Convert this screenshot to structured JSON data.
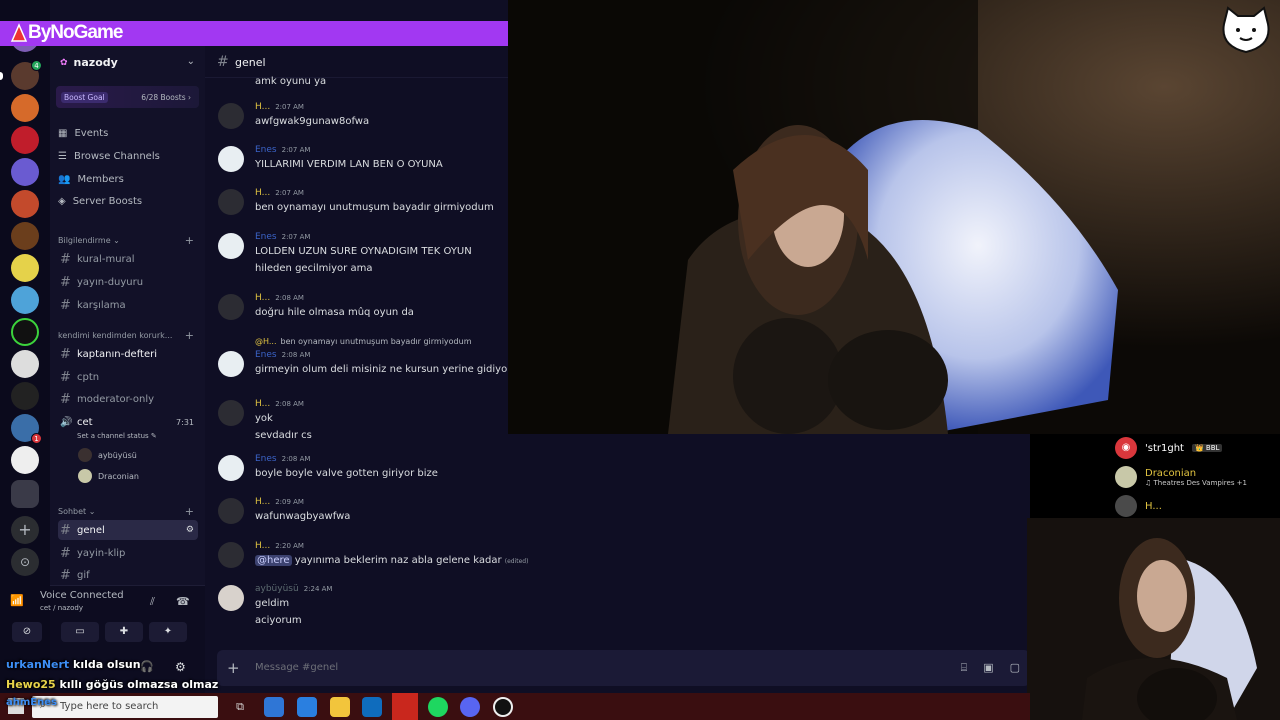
{
  "brand": {
    "text": "ByNoGame"
  },
  "server": {
    "name": "nazody",
    "boost_goal_label": "Boost Goal",
    "boost_progress": "6/28 Boosts"
  },
  "nav": [
    {
      "label": "Events",
      "icon": "calendar-icon"
    },
    {
      "label": "Browse Channels",
      "icon": "browse-icon"
    },
    {
      "label": "Members",
      "icon": "members-icon"
    },
    {
      "label": "Server Boosts",
      "icon": "boost-icon"
    }
  ],
  "categories": {
    "info": "Bilgilendirme",
    "self": "kendimi kendimden korurk...",
    "chat": "Sohbet"
  },
  "channels_info": [
    "kural-mural",
    "yayın-duyuru",
    "karşılama"
  ],
  "channels_self": [
    "kaptanın-defteri",
    "cptn",
    "moderator-only"
  ],
  "voice_channel": {
    "name": "cet",
    "time": "7:31",
    "status": "Set a channel status",
    "users": [
      "aybüyüsü",
      "Draconian"
    ]
  },
  "channels_chat": [
    "genel",
    "yayin-klip",
    "gif"
  ],
  "voice_panel": {
    "title": "Voice Connected",
    "sub": "cet / nazody"
  },
  "chat": {
    "channel": "genel",
    "top_text": "amk oyunu ya",
    "messages": [
      {
        "user": "H...",
        "time": "2:07 AM",
        "lines": [
          "awfgwak9gunaw8ofwa"
        ],
        "color": "yellow",
        "av": "dark"
      },
      {
        "user": "Enes",
        "time": "2:07 AM",
        "lines": [
          "YILLARIMI VERDIM LAN BEN O OYUNA"
        ],
        "color": "blue",
        "av": "ghost"
      },
      {
        "user": "H...",
        "time": "2:07 AM",
        "lines": [
          "ben oynamayı unutmuşum bayadır girmiyodum"
        ],
        "color": "yellow",
        "av": "dark"
      },
      {
        "user": "Enes",
        "time": "2:07 AM",
        "lines": [
          "LOLDEN UZUN SURE OYNADIGIM TEK OYUN",
          "hileden gecilmiyor ama"
        ],
        "color": "blue",
        "av": "ghost"
      },
      {
        "user": "H...",
        "time": "2:08 AM",
        "lines": [
          "doğru hile olmasa mûq oyun da"
        ],
        "color": "yellow",
        "av": "dark"
      },
      {
        "user": "Enes",
        "time": "2:08 AM",
        "lines": [
          "girmeyin olum deli misiniz ne kursun yerine gidiyor ne hile"
        ],
        "color": "blue",
        "av": "ghost",
        "reply_user": "@H...",
        "reply_text": "ben oynamayı unutmuşum bayadır girmiyodum"
      },
      {
        "user": "H...",
        "time": "2:08 AM",
        "lines": [
          "yok",
          "sevdadır cs"
        ],
        "color": "yellow",
        "av": "dark"
      },
      {
        "user": "Enes",
        "time": "2:08 AM",
        "lines": [
          "boyle boyle valve gotten giriyor bize"
        ],
        "color": "blue",
        "av": "ghost"
      },
      {
        "user": "H...",
        "time": "2:09 AM",
        "lines": [
          "wafunwagbyawfwa"
        ],
        "color": "yellow",
        "av": "dark"
      },
      {
        "user": "H...",
        "time": "2:20 AM",
        "lines": [
          "yayınıma beklerim naz abla gelene kadar"
        ],
        "color": "yellow",
        "av": "dark",
        "mention": "@here",
        "edited": "(edited)"
      },
      {
        "user": "aybüyüsü",
        "time": "2:24 AM",
        "lines": [
          "geldim",
          "aciyorum"
        ],
        "color": "grey",
        "av": "girl"
      }
    ],
    "composer_placeholder": "Message #genel"
  },
  "voice_overlay": [
    {
      "name": "'str1ght",
      "badge": "BBL",
      "sub": ""
    },
    {
      "name": "Draconian",
      "badge": "",
      "sub": "Theatres Des Vampires +1"
    },
    {
      "name": "H...",
      "badge": "",
      "sub": ""
    }
  ],
  "chat_overlay": [
    {
      "name": "urkanNert",
      "text": "kılda olsun"
    },
    {
      "name": "Hewo25",
      "text": "kıllı göğüs olmazsa olmaz"
    }
  ],
  "taskbar": {
    "search_placeholder": "Type here to search",
    "overlay_name": "ahmEnes"
  },
  "colors": {
    "brand": "#a238f2",
    "discord_bg": "#0f0e24",
    "taskbar": "#3a0e10",
    "username_yellow": "#e0c341",
    "username_blue": "#3b63c7"
  }
}
